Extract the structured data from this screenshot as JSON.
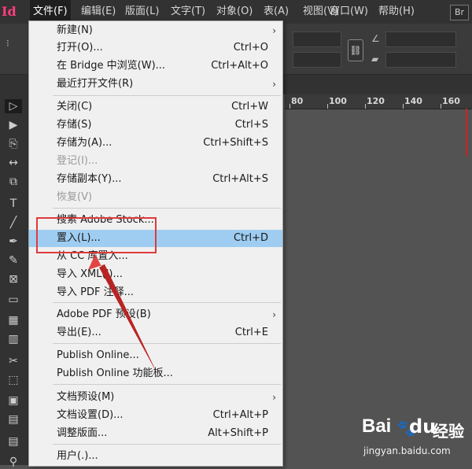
{
  "app": {
    "logo": "Id",
    "bridge_badge": "Br"
  },
  "menubar": {
    "items": [
      {
        "label": "文件(F)",
        "active": true
      },
      {
        "label": "编辑(E)"
      },
      {
        "label": "版面(L)"
      },
      {
        "label": "文字(T)"
      },
      {
        "label": "对象(O)"
      },
      {
        "label": "表(A)"
      },
      {
        "label": "视图(V)"
      },
      {
        "label": "窗口(W)"
      },
      {
        "label": "帮助(H)"
      }
    ]
  },
  "ruler": {
    "labels": [
      "80",
      "100",
      "120",
      "140",
      "160"
    ]
  },
  "file_menu": {
    "items": [
      {
        "label": "新建(N)",
        "submenu": "›"
      },
      {
        "label": "打开(O)...",
        "shortcut": "Ctrl+O"
      },
      {
        "label": "在 Bridge 中浏览(W)...",
        "shortcut": "Ctrl+Alt+O"
      },
      {
        "label": "最近打开文件(R)",
        "submenu": "›"
      },
      {
        "label": "关闭(C)",
        "shortcut": "Ctrl+W"
      },
      {
        "label": "存储(S)",
        "shortcut": "Ctrl+S"
      },
      {
        "label": "存储为(A)...",
        "shortcut": "Ctrl+Shift+S"
      },
      {
        "label": "登记(I)...",
        "disabled": true
      },
      {
        "label": "存储副本(Y)...",
        "shortcut": "Ctrl+Alt+S"
      },
      {
        "label": "恢复(V)",
        "disabled": true
      },
      {
        "label": "搜索 Adobe Stock..."
      },
      {
        "label": "置入(L)...",
        "shortcut": "Ctrl+D",
        "highlighted": true
      },
      {
        "label": "从 CC 库置入..."
      },
      {
        "label": "导入 XML(I)..."
      },
      {
        "label": "导入 PDF 注释..."
      },
      {
        "label": "Adobe PDF 预设(B)",
        "submenu": "›"
      },
      {
        "label": "导出(E)...",
        "shortcut": "Ctrl+E"
      },
      {
        "label": "Publish Online..."
      },
      {
        "label": "Publish Online 功能板..."
      },
      {
        "label": "文档预设(M)",
        "submenu": "›"
      },
      {
        "label": "文档设置(D)...",
        "shortcut": "Ctrl+Alt+P"
      },
      {
        "label": "调整版面...",
        "shortcut": "Alt+Shift+P"
      },
      {
        "label": "用户(.)..."
      }
    ]
  },
  "tools": [
    {
      "icon": "selection-tool-icon",
      "glyph": "▷"
    },
    {
      "icon": "direct-selection-icon",
      "glyph": "▶"
    },
    {
      "icon": "page-tool-icon",
      "glyph": "⎘"
    },
    {
      "icon": "gap-tool-icon",
      "glyph": "↔"
    },
    {
      "icon": "content-collector-icon",
      "glyph": "⧉"
    },
    {
      "icon": "type-tool-icon",
      "glyph": "T"
    },
    {
      "icon": "line-tool-icon",
      "glyph": "╱"
    },
    {
      "icon": "pen-tool-icon",
      "glyph": "✒"
    },
    {
      "icon": "pencil-tool-icon",
      "glyph": "✎"
    },
    {
      "icon": "rectangle-frame-icon",
      "glyph": "⊠"
    },
    {
      "icon": "rectangle-tool-icon",
      "glyph": "▭"
    },
    {
      "icon": "table-tool-icon",
      "glyph": "▦"
    },
    {
      "icon": "grid-tool-icon",
      "glyph": "▥"
    },
    {
      "icon": "scissors-icon",
      "glyph": "✂"
    },
    {
      "icon": "free-transform-icon",
      "glyph": "⬚"
    },
    {
      "icon": "gradient-icon",
      "glyph": "▣"
    },
    {
      "icon": "gradient-feather-icon",
      "glyph": "▤"
    },
    {
      "icon": "note-tool-icon",
      "glyph": "▤"
    },
    {
      "icon": "eyedropper-icon",
      "glyph": "⚲"
    }
  ],
  "watermark": {
    "brand": "Bai",
    "brand_du": "du",
    "cn": "经验",
    "url": "jingyan.baidu.com"
  },
  "colors": {
    "menu_highlight": "#9fcdf2",
    "annotation_red": "#e03a3a",
    "app_logo": "#ff3d7f"
  }
}
